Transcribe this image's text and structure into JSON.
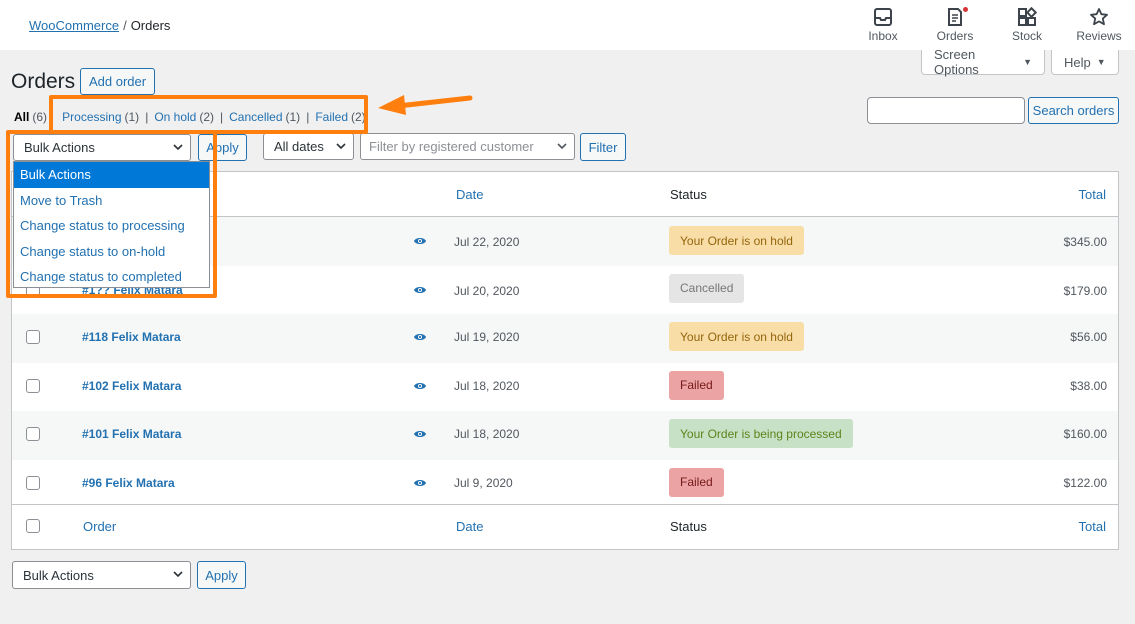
{
  "breadcrumb": {
    "root": "WooCommerce",
    "separator": "/",
    "current": "Orders"
  },
  "header_actions": [
    {
      "label": "Inbox",
      "icon": "inbox-icon"
    },
    {
      "label": "Orders",
      "icon": "orders-icon"
    },
    {
      "label": "Stock",
      "icon": "stock-icon"
    },
    {
      "label": "Reviews",
      "icon": "star-icon"
    }
  ],
  "screen_options": {
    "label": "Screen Options"
  },
  "help": {
    "label": "Help"
  },
  "page": {
    "title": "Orders",
    "add_button": "Add order"
  },
  "views": {
    "all": {
      "label": "All",
      "count": "(6)"
    },
    "processing": {
      "label": "Processing",
      "count": "(1)"
    },
    "on_hold": {
      "label": "On hold",
      "count": "(2)"
    },
    "cancelled": {
      "label": "Cancelled",
      "count": "(1)"
    },
    "failed": {
      "label": "Failed",
      "count": "(2)"
    },
    "separator": "|"
  },
  "search": {
    "placeholder": "",
    "button": "Search orders"
  },
  "filters": {
    "bulk_actions": "Bulk Actions",
    "apply": "Apply",
    "dates": "All dates",
    "customer_placeholder": "Filter by registered customer",
    "filter_button": "Filter"
  },
  "bulk_dropdown": {
    "options": [
      "Bulk Actions",
      "Move to Trash",
      "Change status to processing",
      "Change status to on-hold",
      "Change status to completed"
    ]
  },
  "table": {
    "columns": {
      "order": "Order",
      "date": "Date",
      "status": "Status",
      "total": "Total"
    },
    "rows": [
      {
        "order": "",
        "date": "Jul 22, 2020",
        "status": "Your Order is on hold",
        "total": "$345.00"
      },
      {
        "order": "#1?? Felix Matara",
        "date": "Jul 20, 2020",
        "status": "Cancelled",
        "total": "$179.00"
      },
      {
        "order": "#118 Felix Matara",
        "date": "Jul 19, 2020",
        "status": "Your Order is on hold",
        "total": "$56.00"
      },
      {
        "order": "#102 Felix Matara",
        "date": "Jul 18, 2020",
        "status": "Failed",
        "total": "$38.00"
      },
      {
        "order": "#101 Felix Matara",
        "date": "Jul 18, 2020",
        "status": "Your Order is being processed",
        "total": "$160.00"
      },
      {
        "order": "#96 Felix Matara",
        "date": "Jul 9, 2020",
        "status": "Failed",
        "total": "$122.00"
      }
    ]
  },
  "bottom": {
    "bulk_actions": "Bulk Actions",
    "apply": "Apply"
  },
  "colors": {
    "accent": "#2271b1",
    "highlight": "#ff7f0e",
    "selected": "#0078d7"
  }
}
